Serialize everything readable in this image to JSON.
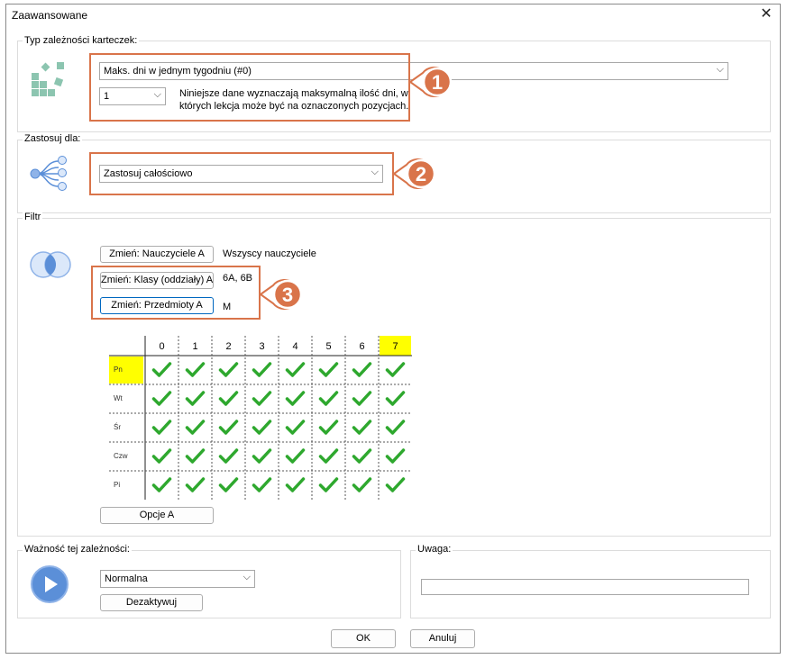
{
  "window": {
    "title": "Zaawansowane",
    "close_icon": "close-icon"
  },
  "type_group": {
    "label": "Typ zależności karteczek:",
    "type_value": "Maks. dni w jednym tygodniu (#0)",
    "count_value": "1",
    "description_line1": "Niniejsze dane wyznaczają maksymalną ilość dni, w",
    "description_line2": "których lekcja może być na oznaczonych pozycjach.",
    "callout_number": "1"
  },
  "apply_group": {
    "label": "Zastosuj dla:",
    "apply_value": "Zastosuj całościowo",
    "callout_number": "2"
  },
  "filter_group": {
    "label": "Filtr",
    "teachers_button": "Zmień: Nauczyciele A",
    "teachers_value": "Wszyscy nauczyciele",
    "classes_button": "Zmień: Klasy (oddziały) A",
    "classes_value": "6A, 6B",
    "subjects_button": "Zmień: Przedmioty A",
    "subjects_value": "M",
    "callout_number": "3",
    "options_button": "Opcje A"
  },
  "grid": {
    "columns": [
      "0",
      "1",
      "2",
      "3",
      "4",
      "5",
      "6",
      "7"
    ],
    "rows": [
      "Pn",
      "Wt",
      "Śr",
      "Czw",
      "Pi"
    ],
    "highlight_column": "7",
    "highlight_row": "Pn",
    "highlight_color": "#ffff00",
    "check_color": "#2ea82e",
    "cell_state": "checked"
  },
  "importance_group": {
    "label": "Ważność tej zależności:",
    "value": "Normalna",
    "deactivate_button": "Dezaktywuj"
  },
  "note_group": {
    "label": "Uwaga:",
    "value": ""
  },
  "footer": {
    "ok_button": "OK",
    "cancel_button": "Anuluj"
  },
  "colors": {
    "callout_border": "#d9744a",
    "badge_fill": "#d9744a",
    "icon_teal": "#8cc5b0",
    "icon_blue": "#5b8fd8"
  }
}
